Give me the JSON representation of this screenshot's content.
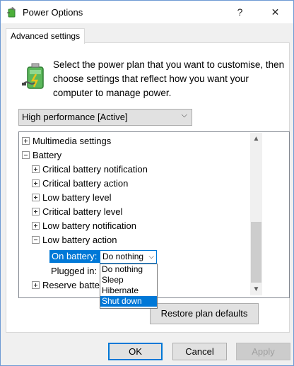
{
  "window": {
    "title": "Power Options",
    "help_glyph": "?",
    "close_glyph": "✕"
  },
  "tab": {
    "label": "Advanced settings"
  },
  "intro": "Select the power plan that you want to customise, then choose settings that reflect how you want your computer to manage power.",
  "plan_select": {
    "value": "High performance [Active]",
    "chevron": "⌵"
  },
  "tree": {
    "items": [
      {
        "label": "Multimedia settings"
      },
      {
        "label": "Battery"
      },
      {
        "label": "Critical battery notification"
      },
      {
        "label": "Critical battery action"
      },
      {
        "label": "Low battery level"
      },
      {
        "label": "Critical battery level"
      },
      {
        "label": "Low battery notification"
      },
      {
        "label": "Low battery action"
      }
    ],
    "on_battery_label": "On battery:",
    "on_battery_value": "Do nothing",
    "plugged_in_label": "Plugged in:",
    "reserve_label": "Reserve batter"
  },
  "dropdown": {
    "options": [
      "Do nothing",
      "Sleep",
      "Hibernate",
      "Shut down"
    ],
    "highlighted": "Shut down"
  },
  "buttons": {
    "restore": "Restore plan defaults",
    "ok": "OK",
    "cancel": "Cancel",
    "apply": "Apply"
  },
  "colors": {
    "accent": "#0078d7",
    "disabled_text": "#a0a0a0"
  },
  "icons": {
    "title": "power-options-battery-icon",
    "hero": "battery-power-plan-icon"
  }
}
